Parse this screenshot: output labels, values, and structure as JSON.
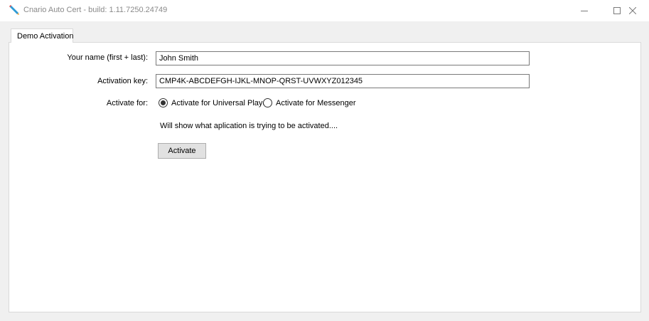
{
  "window": {
    "title": "Cnario Auto Cert - build: 1.11.7250.24749"
  },
  "tabs": [
    {
      "label": "Demo Activation",
      "selected": true
    }
  ],
  "form": {
    "name_label": "Your name (first + last):",
    "name_value": "John Smith",
    "key_label": "Activation key:",
    "key_value": "CMP4K-ABCDEFGH-IJKL-MNOP-QRST-UVWXYZ012345",
    "activate_for_label": "Activate for:",
    "options": [
      {
        "label": "Activate for Universal Player",
        "selected": true
      },
      {
        "label": "Activate for Messenger",
        "selected": false
      }
    ],
    "status_text": "Will show what aplication is trying to be activated....",
    "activate_button": "Activate"
  },
  "icons": {
    "app": "pencil-icon",
    "minimize": "minimize-icon",
    "maximize": "maximize-icon",
    "close": "close-icon"
  }
}
